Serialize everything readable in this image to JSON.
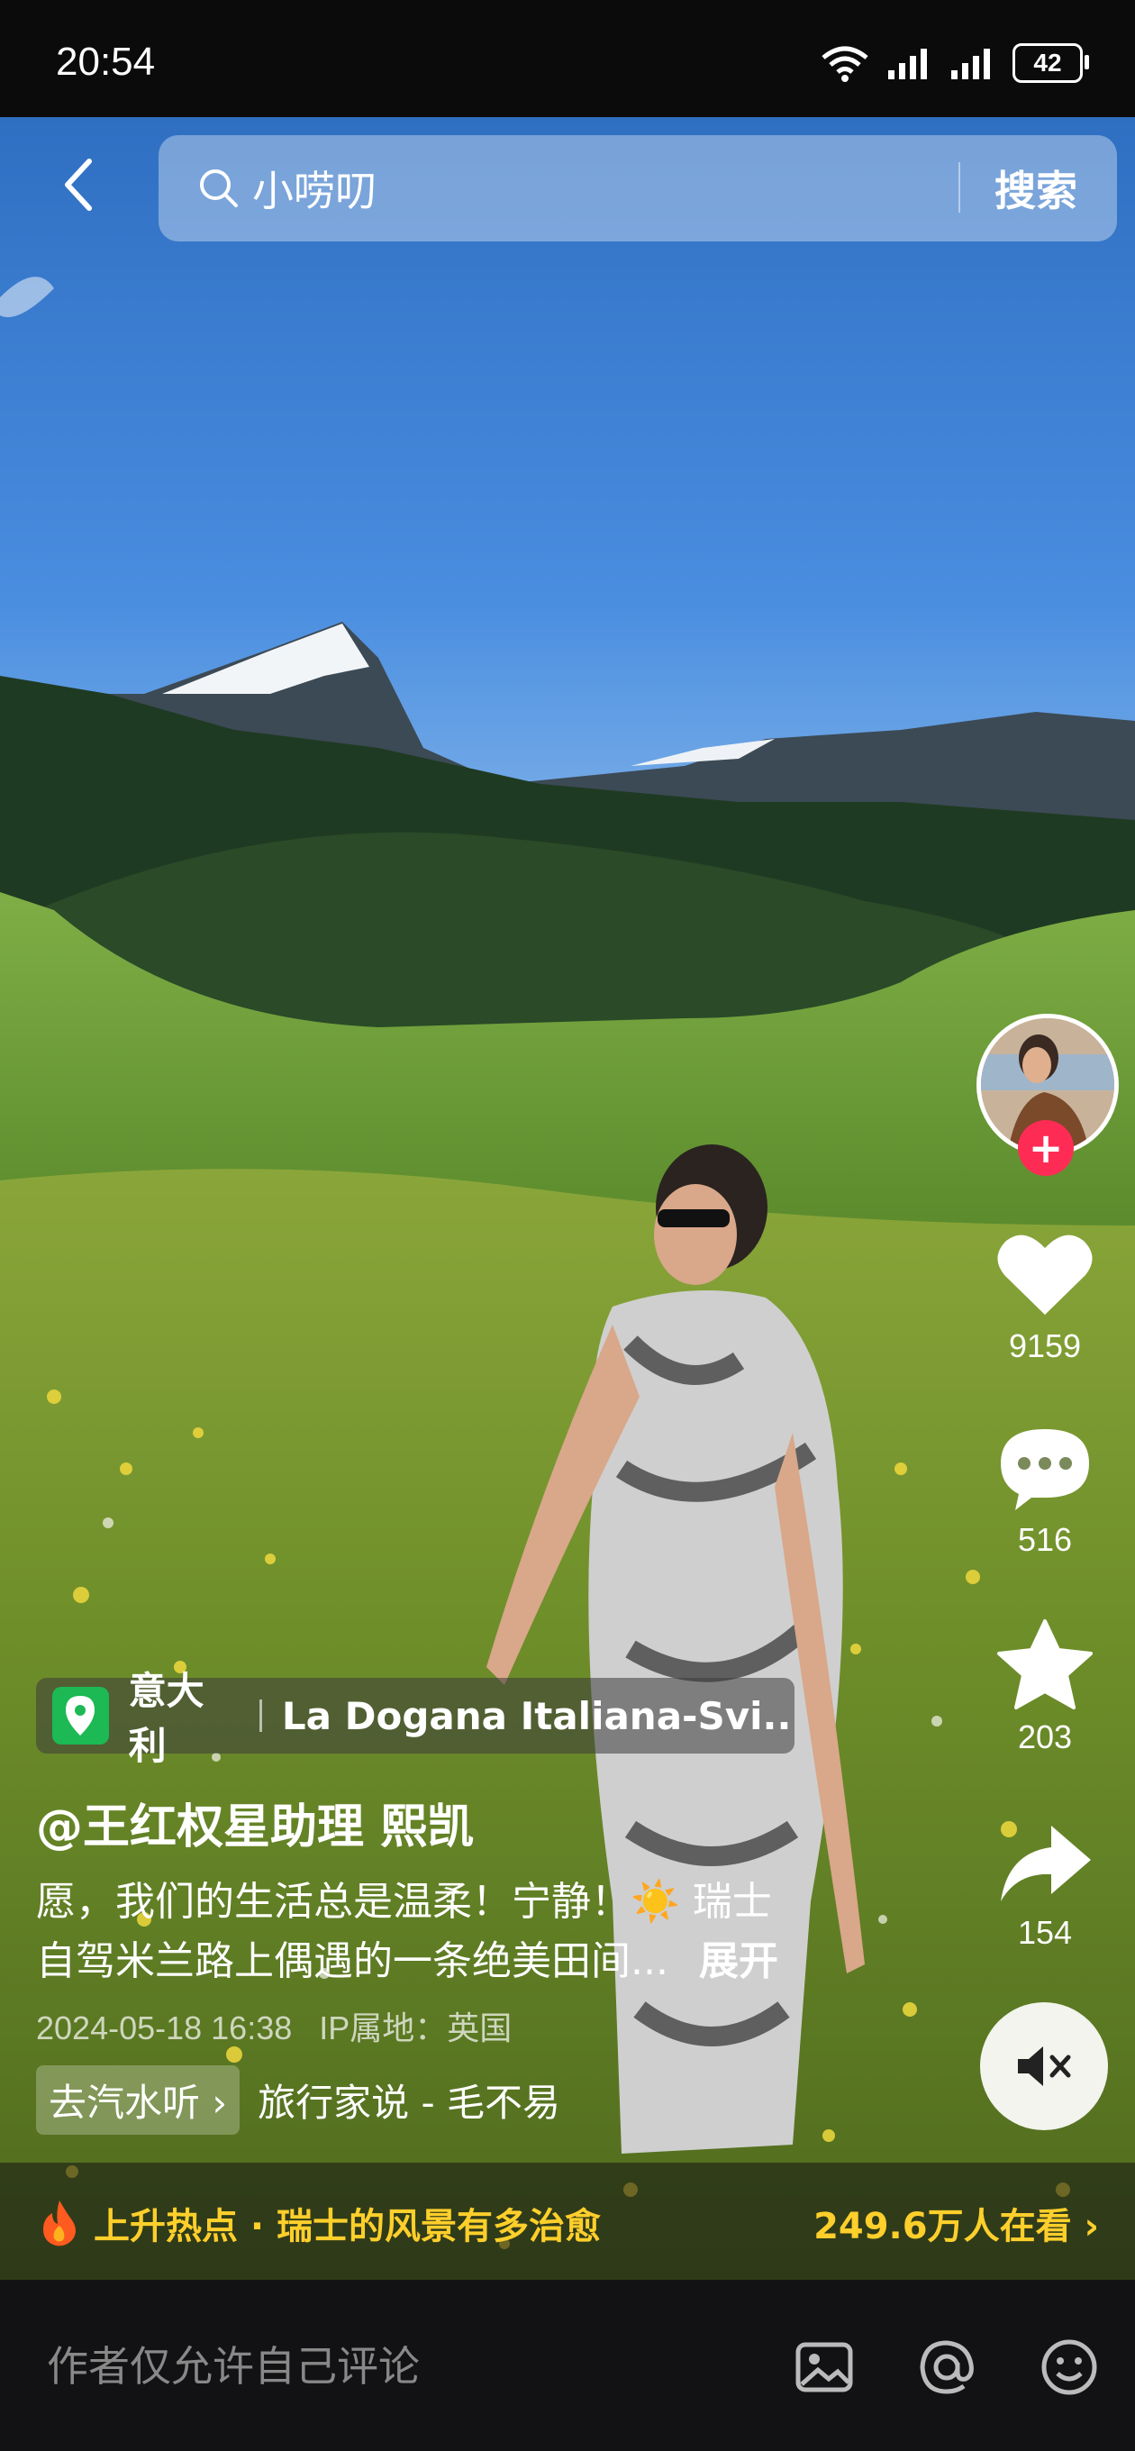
{
  "status_bar": {
    "time": "20:54",
    "battery": "42"
  },
  "search": {
    "query": "小唠叨",
    "button_label": "搜索"
  },
  "actions": {
    "like_count": "9159",
    "comment_count": "516",
    "favorite_count": "203",
    "share_count": "154"
  },
  "location": {
    "country": "意大利",
    "place": "La Dogana Italiana-Svi..."
  },
  "post": {
    "author": "@王红权星助理 熙凯",
    "description_line1": "愿，我们的生活总是温柔！宁静！☀️ 瑞士",
    "description_line2": "自驾米兰路上偶遇的一条绝美田间...",
    "expand_label": "展开",
    "timestamp": "2024-05-18 16:38",
    "ip_location": "IP属地：英国"
  },
  "music": {
    "chip_label": "去汽水听 ›",
    "track": "旅行家说 - 毛不易"
  },
  "hot": {
    "label": "上升热点 · 瑞士的风景有多治愈",
    "viewers": "249.6万人在看 ›"
  },
  "comment_bar": {
    "placeholder": "作者仅允许自己评论"
  },
  "colors": {
    "accent_red": "#fe2c55",
    "hot_yellow": "#ffcf2b",
    "location_green": "#1db954"
  }
}
